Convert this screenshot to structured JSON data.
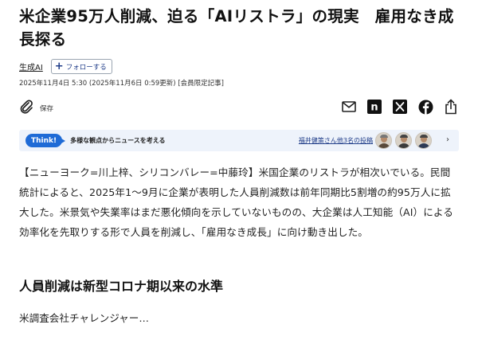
{
  "article": {
    "headline": "米企業95万人削減、迫る「AIリストラ」の現実　雇用なき成長探る",
    "topic_link": "生成AI",
    "follow_label": "フォローする",
    "date_line": "2025年11月4日 5:30 (2025年11月6日 0:59更新) [会員限定記事]",
    "save_label": "保存",
    "body": "【ニューヨーク=川上梓、シリコンバレー=中藤玲】米国企業のリストラが相次いでいる。民間統計によると、2025年1〜9月に企業が表明した人員削減数は前年同期比5割増の約95万人に拡大した。米景気や失業率はまだ悪化傾向を示していないものの、大企業は人工知能（AI）による効率化を先取りする形で人員を削減し、「雇用なき成長」に向け動き出した。",
    "subheading": "人員削減は新型コロナ期以来の水準",
    "teaser": "米調査会社チャレンジャー…"
  },
  "think": {
    "badge": "Think!",
    "description": "多様な観点からニュースを考える",
    "posts_link": "福井健策さん他3名の投稿"
  },
  "share": {
    "icons": [
      "mail-icon",
      "note-icon",
      "x-icon",
      "facebook-icon",
      "share-icon"
    ],
    "note_letter": "n"
  },
  "colors": {
    "accent_blue": "#1f6bd6",
    "link_navy": "#1f3c88",
    "think_bg": "#eef3fb"
  }
}
